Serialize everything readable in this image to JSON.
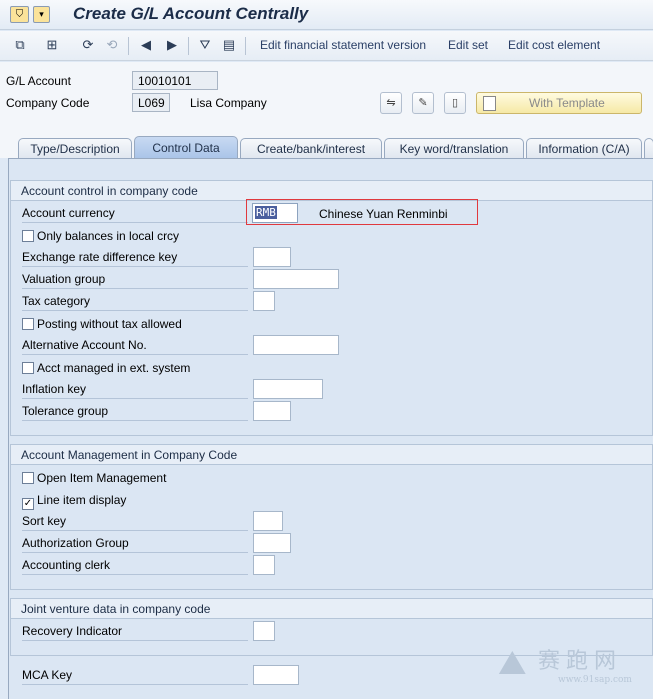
{
  "title": "Create G/L Account Centrally",
  "toolbar": {
    "links": [
      "Edit financial statement version",
      "Edit set",
      "Edit cost element"
    ]
  },
  "header": {
    "gl_account_label": "G/L Account",
    "gl_account_value": "10010101",
    "company_code_label": "Company Code",
    "company_code_value": "L069",
    "company_name": "Lisa Company",
    "with_template_label": "With Template"
  },
  "tabs": [
    "Type/Description",
    "Control Data",
    "Create/bank/interest",
    "Key word/translation",
    "Information (C/A)"
  ],
  "active_tab": "Control Data",
  "account_control": {
    "title": "Account control in company code",
    "account_currency_label": "Account currency",
    "account_currency_value": "RMB",
    "account_currency_desc": "Chinese Yuan Renminbi",
    "only_balances_label": "Only balances in local crcy",
    "exchange_rate_label": "Exchange rate difference key",
    "valuation_group_label": "Valuation group",
    "tax_category_label": "Tax category",
    "posting_without_tax_label": "Posting without tax allowed",
    "alternative_account_label": "Alternative Account No.",
    "acct_managed_ext_label": "Acct managed in ext. system",
    "inflation_key_label": "Inflation key",
    "tolerance_group_label": "Tolerance group"
  },
  "account_management": {
    "title": "Account Management in Company Code",
    "open_item_label": "Open Item Management",
    "open_item_checked": false,
    "line_item_label": "Line item display",
    "line_item_checked": true,
    "sort_key_label": "Sort key",
    "authorization_group_label": "Authorization Group",
    "accounting_clerk_label": "Accounting clerk"
  },
  "joint_venture": {
    "title": "Joint venture data in company code",
    "recovery_indicator_label": "Recovery Indicator"
  },
  "mca_key_label": "MCA Key",
  "watermark": {
    "text": "赛跑网",
    "url": "www.91sap.com"
  }
}
